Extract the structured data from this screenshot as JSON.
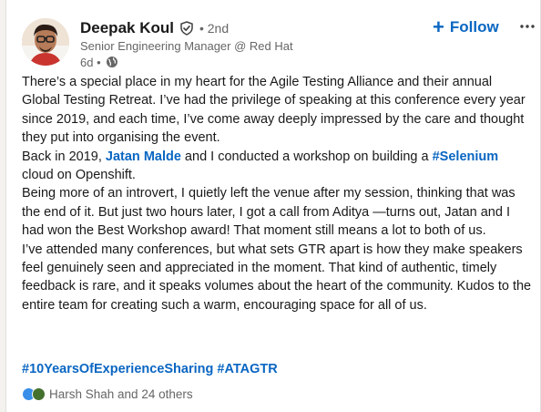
{
  "author": {
    "name": "Deepak Koul",
    "degree": "• 2nd",
    "headline": "Senior Engineering Manager @ Red Hat",
    "time": "6d •"
  },
  "actions": {
    "follow_plus": "+",
    "follow_label": "Follow",
    "more_label": "···"
  },
  "post": {
    "p1": "There’s a special place in my heart for the Agile Testing Alliance and their annual Global Testing Retreat. I’ve had the privilege of speaking at this conference every year since 2019, and each time, I’ve come away deeply impressed by the care and thought they put into organising the event.",
    "p2_before": "Back in 2019, ",
    "p2_mention": "Jatan Malde",
    "p2_middle": " and I conducted a workshop on building a ",
    "p2_hashtag": "#Selenium",
    "p2_after": " cloud on Openshift.",
    "p3": "Being more of an introvert, I quietly left the venue after my session, thinking that was the end of it. But just two hours later, I got a call from Aditya —turns out, Jatan and I had won the Best Workshop award! That moment still means a lot to both of us.",
    "p4": "I’ve attended many conferences, but what sets GTR apart is how they make speakers feel genuinely seen and appreciated in the moment. That kind of authentic, timely feedback is rare, and it speaks volumes about the heart of the community. Kudos to the entire team for creating such a warm, encouraging space for all of us."
  },
  "hashtags": [
    "#10YearsOfExperienceSharing",
    "#ATAGTR"
  ],
  "reactions": {
    "text": "Harsh Shah and 24 others"
  },
  "icons": {
    "verified": "verified-shield-icon",
    "globe": "globe-icon",
    "more": "ellipsis-icon"
  },
  "colors": {
    "link": "#0a66c2",
    "text": "#191919",
    "muted": "#666666"
  }
}
